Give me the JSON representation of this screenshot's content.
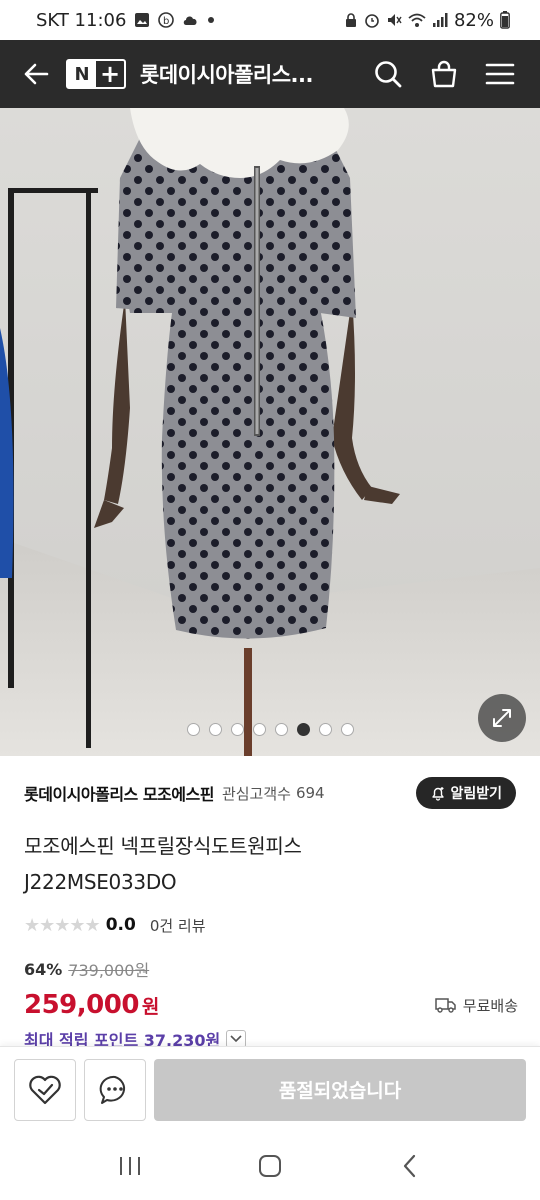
{
  "status_bar": {
    "carrier_time": "SKT 11:06",
    "battery": "82%"
  },
  "header": {
    "logo_n": "N",
    "logo_plus": "+",
    "title": "롯데이시아폴리스..."
  },
  "gallery": {
    "image_count": 8,
    "active_index": 5
  },
  "brand": {
    "name": "롯데이시아폴리스 모조에스핀",
    "follower_label": "관심고객수",
    "follower_count": "694",
    "alarm_label": "알림받기"
  },
  "product": {
    "name_line1": "모조에스핀 넥프릴장식도트원피스",
    "name_line2": "J222MSE033DO"
  },
  "rating": {
    "stars": "★★★★★",
    "score": "0.0",
    "reviews": "0건 리뷰"
  },
  "price": {
    "discount_rate": "64%",
    "original": "739,000원",
    "sale": "259,000",
    "sale_unit": "원",
    "shipping": "무료배송"
  },
  "points": {
    "label": "최대 적립 포인트 37,230원"
  },
  "bottom": {
    "soldout_label": "품절되었습니다"
  },
  "colors": {
    "header_bg": "#2b2b2b",
    "sale_red": "#c8102e",
    "points_purple": "#5b3fa8",
    "soldout_gray": "#c7c7c7"
  }
}
